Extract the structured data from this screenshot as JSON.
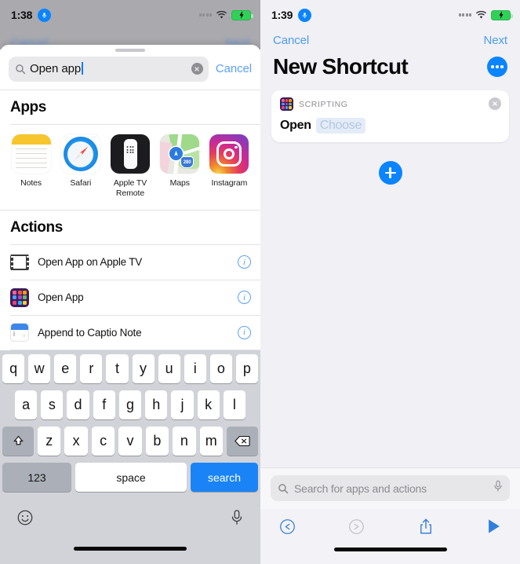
{
  "left_phone": {
    "status_bar": {
      "time": "1:38",
      "mic_icon": "microphone-badge-icon",
      "signal_icon": "cellular-dots-icon",
      "wifi_icon": "wifi-icon",
      "battery_icon": "battery-charging-icon"
    },
    "backdrop": {
      "cancel_label": "Cancel",
      "next_label": "Next"
    },
    "search": {
      "value": "Open app",
      "icon": "search-icon",
      "clear_icon": "clear-circle-icon",
      "cancel_label": "Cancel"
    },
    "apps_section": {
      "heading": "Apps",
      "items": [
        {
          "label": "Notes",
          "icon": "notes-app-icon"
        },
        {
          "label": "Safari",
          "icon": "safari-app-icon"
        },
        {
          "label": "Apple TV Remote",
          "icon": "apple-tv-remote-app-icon"
        },
        {
          "label": "Maps",
          "icon": "maps-app-icon"
        },
        {
          "label": "Instagram",
          "icon": "instagram-app-icon"
        }
      ]
    },
    "actions_section": {
      "heading": "Actions",
      "items": [
        {
          "label": "Open App on Apple TV",
          "icon": "film-frame-icon",
          "info_icon": "info-icon"
        },
        {
          "label": "Open App",
          "icon": "scripting-grid-icon",
          "info_icon": "info-icon"
        },
        {
          "label": "Append to Captio Note",
          "icon": "captio-note-icon",
          "info_icon": "info-icon"
        }
      ]
    },
    "keyboard": {
      "row1": [
        "q",
        "w",
        "e",
        "r",
        "t",
        "y",
        "u",
        "i",
        "o",
        "p"
      ],
      "row2": [
        "a",
        "s",
        "d",
        "f",
        "g",
        "h",
        "j",
        "k",
        "l"
      ],
      "row3": [
        "z",
        "x",
        "c",
        "v",
        "b",
        "n",
        "m"
      ],
      "shift_icon": "shift-key-icon",
      "backspace_icon": "backspace-key-icon",
      "numbers_label": "123",
      "space_label": "space",
      "return_label": "search",
      "emoji_icon": "emoji-key-icon",
      "dictation_icon": "dictation-mic-icon"
    }
  },
  "right_phone": {
    "status_bar": {
      "time": "1:39",
      "mic_icon": "microphone-badge-icon",
      "signal_icon": "cellular-dots-icon",
      "wifi_icon": "wifi-icon",
      "battery_icon": "battery-charging-icon"
    },
    "nav": {
      "cancel_label": "Cancel",
      "next_label": "Next"
    },
    "title": "New Shortcut",
    "more_icon": "more-options-icon",
    "action_card": {
      "category": "SCRIPTING",
      "icon": "scripting-grid-icon",
      "remove_icon": "remove-action-icon",
      "verb": "Open",
      "parameter_token": "Choose"
    },
    "add_action_icon": "add-action-plus-icon",
    "search_dock": {
      "placeholder": "Search for apps and actions",
      "icon": "search-icon",
      "mic_icon": "dictation-mic-icon"
    },
    "toolbar": {
      "undo_icon": "undo-icon",
      "redo_icon": "redo-icon",
      "share_icon": "share-icon",
      "play_icon": "play-icon"
    }
  },
  "colors": {
    "accent_blue": "#0a84ff",
    "link_blue": "#4c9cf2",
    "keyboard_bg": "#d1d3d9",
    "canvas_bg": "#f1f0f5",
    "token_bg": "#e4ecf8",
    "battery_green": "#31d158"
  }
}
